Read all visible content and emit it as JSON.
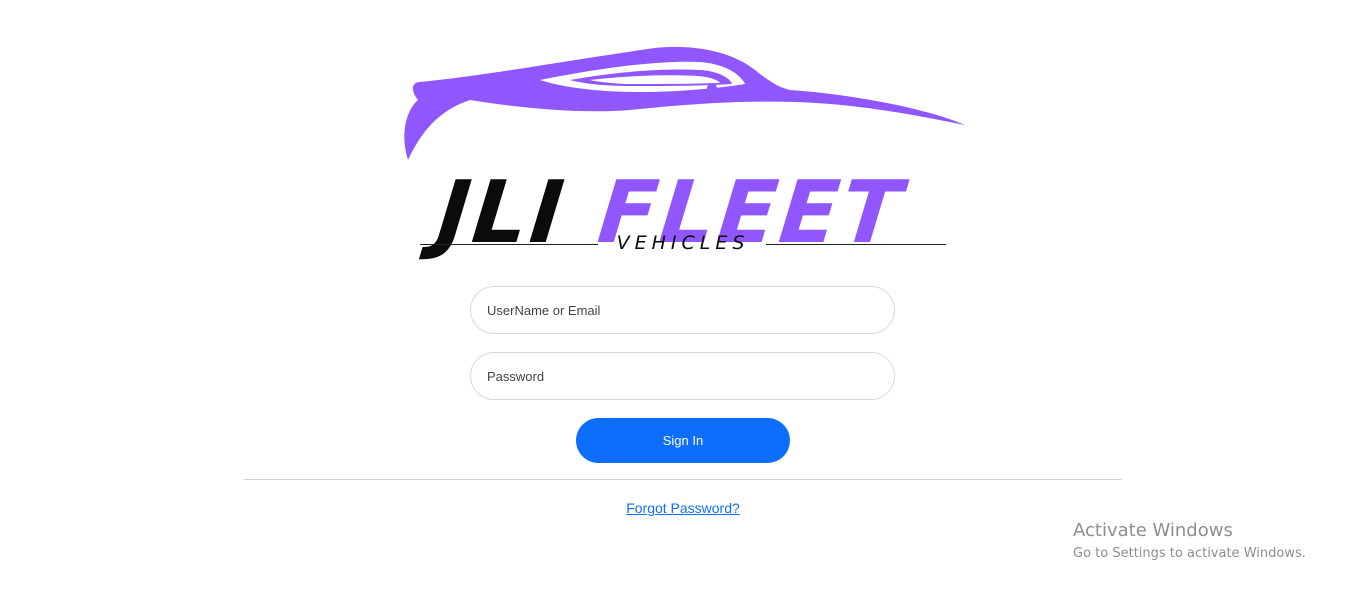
{
  "logo": {
    "word_dark": "JLI",
    "word_accent": "FLEET",
    "subtitle": "VEHICLES",
    "accent_color": "#9057ff"
  },
  "form": {
    "username": {
      "placeholder": "UserName or Email",
      "value": ""
    },
    "password": {
      "placeholder": "Password",
      "value": ""
    },
    "signin_label": "Sign In",
    "forgot_label": "Forgot Password?",
    "primary_color": "#0d6efd"
  },
  "watermark": {
    "title": "Activate Windows",
    "subtitle": "Go to Settings to activate Windows."
  }
}
